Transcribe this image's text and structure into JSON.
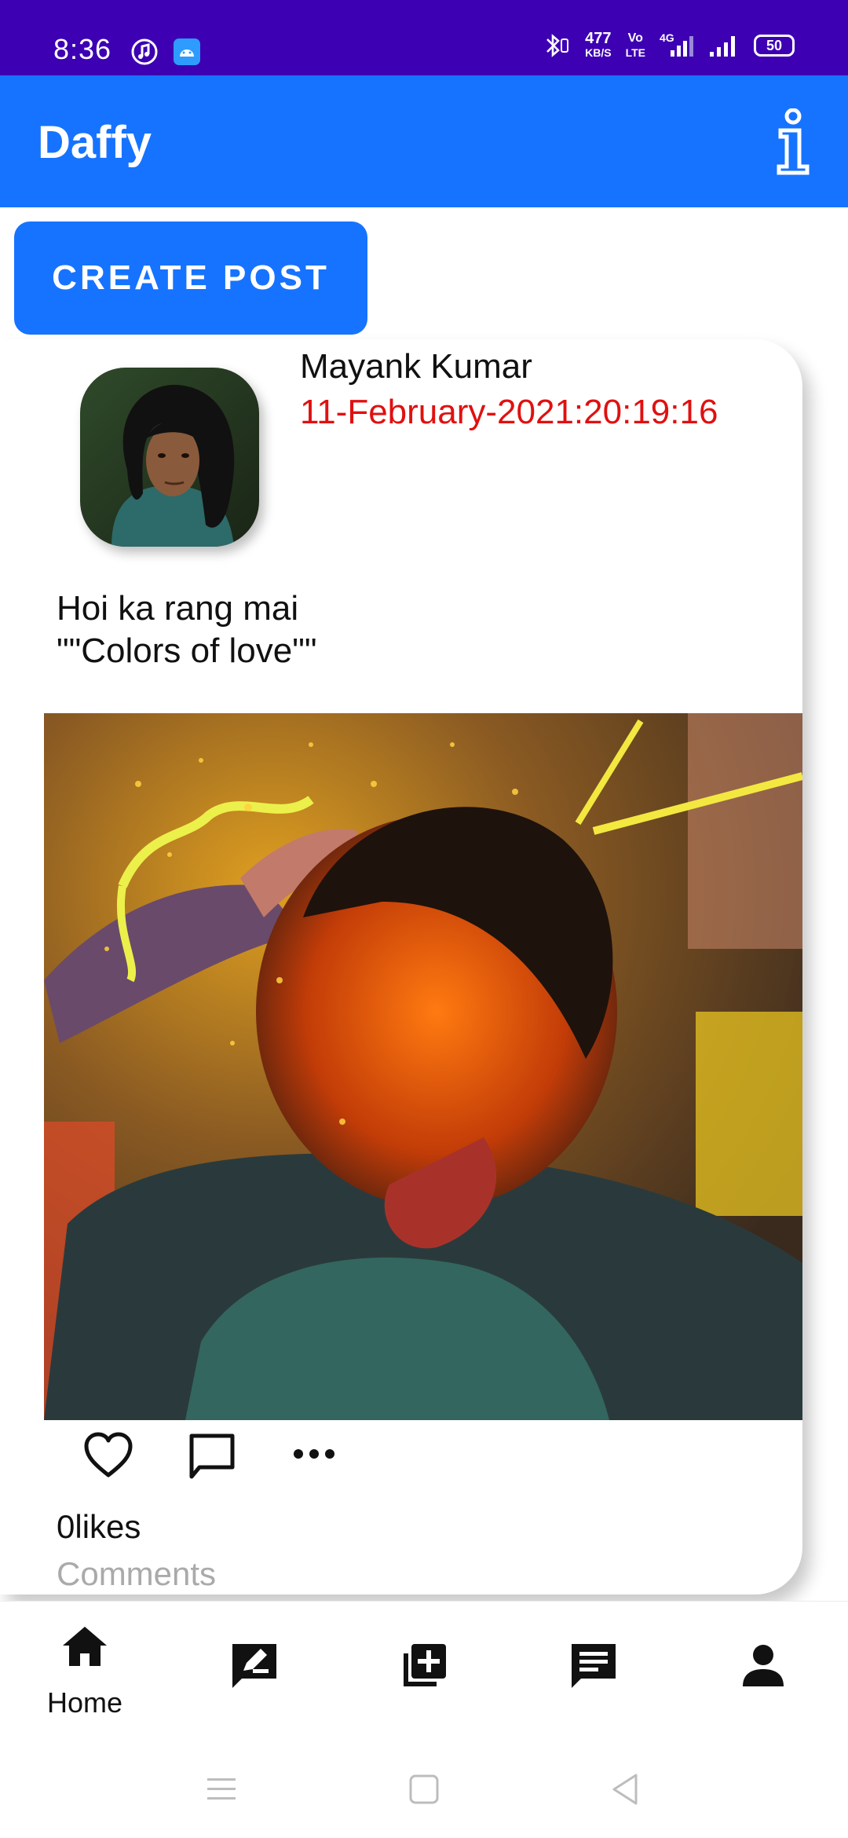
{
  "status_bar": {
    "time": "8:36",
    "net_speed_value": "477",
    "net_speed_unit": "KB/S",
    "volte_top": "Vo",
    "volte_bottom": "LTE",
    "network": "4G",
    "battery": "50"
  },
  "app_bar": {
    "title": "Daffy",
    "info_icon": "info-icon"
  },
  "create_post": {
    "label": "CREATE POST"
  },
  "post": {
    "author": "Mayank Kumar",
    "date": "11-February-2021:20:19:16",
    "caption_line1": "Hoi ka rang mai",
    "caption_line2": "\"\"Colors of love\"\"",
    "likes": "0likes",
    "comments": "Comments",
    "actions": [
      "heart-icon",
      "comment-icon",
      "more-icon"
    ]
  },
  "bottom_nav": {
    "items": [
      {
        "label": "Home",
        "icon": "home-icon",
        "active": true
      },
      {
        "label": "",
        "icon": "edit-post-icon",
        "active": false
      },
      {
        "label": "",
        "icon": "add-box-icon",
        "active": false
      },
      {
        "label": "",
        "icon": "chat-icon",
        "active": false
      },
      {
        "label": "",
        "icon": "person-icon",
        "active": false
      }
    ]
  },
  "colors": {
    "status_bar": "#3d00b3",
    "primary": "#1673ff",
    "date_red": "#e01010",
    "muted": "#aaaaaa"
  }
}
